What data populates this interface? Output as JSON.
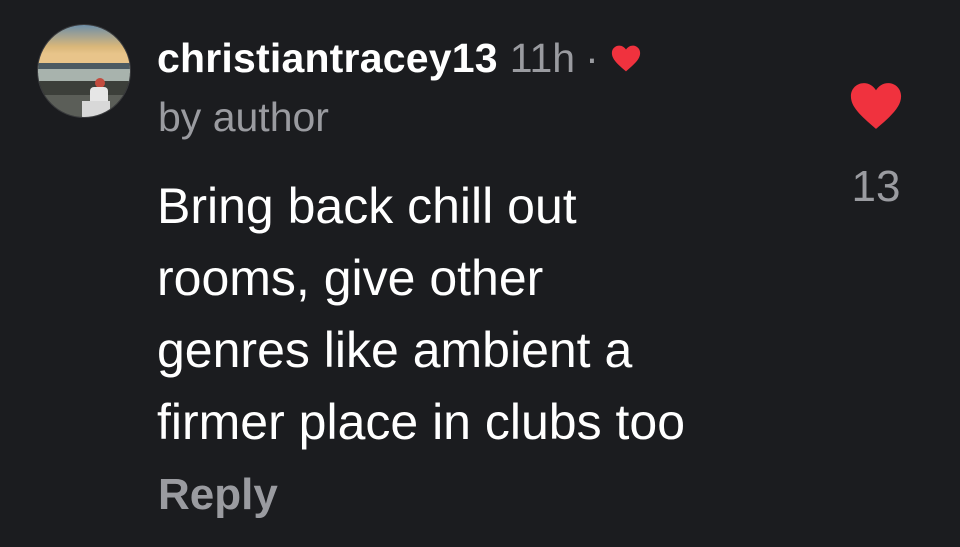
{
  "comment": {
    "username": "christiantracey13",
    "time": "11h",
    "separator": "·",
    "badge": "by author",
    "text_lines": [
      "Bring back chill out",
      "rooms, give other",
      "genres like ambient a",
      "firmer place in clubs too"
    ],
    "reply_label": "Reply",
    "like_count": "13",
    "liked": true
  },
  "icons": {
    "author_heart": "heart-icon",
    "like": "heart-icon",
    "avatar": "avatar-image"
  },
  "colors": {
    "background": "#1b1c1f",
    "heart": "#f0323e",
    "secondary_text": "#9a9ba0",
    "primary_text": "#ffffff"
  }
}
